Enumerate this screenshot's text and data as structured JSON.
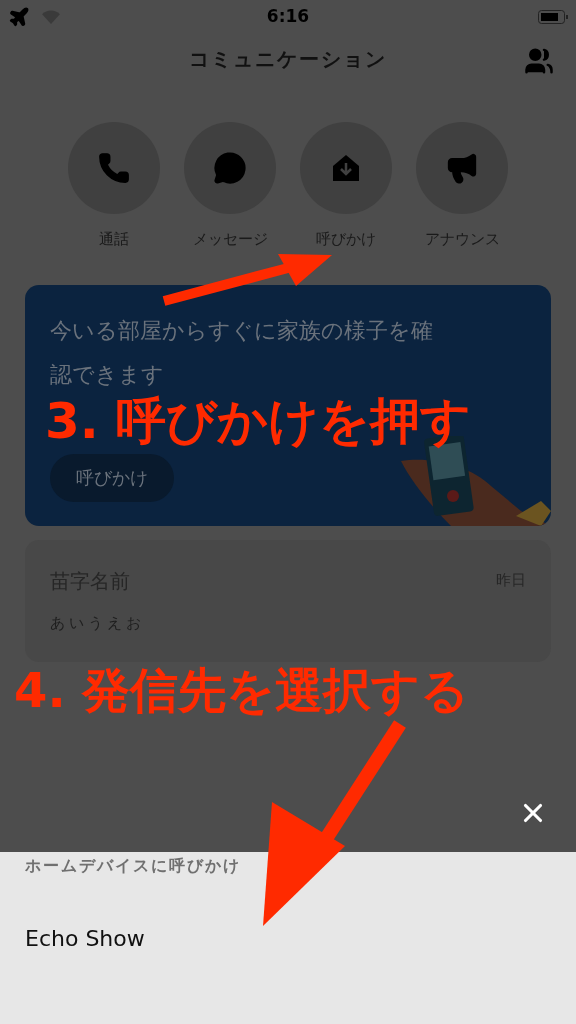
{
  "status_bar": {
    "time": "6:16"
  },
  "header": {
    "title": "コミュニケーション"
  },
  "actions": [
    {
      "kind": "call",
      "label": "通話"
    },
    {
      "kind": "message",
      "label": "メッセージ"
    },
    {
      "kind": "drop_in",
      "label": "呼びかけ"
    },
    {
      "kind": "announce",
      "label": "アナウンス"
    }
  ],
  "banner": {
    "text": "今いる部屋からすぐに家族の様子を確認できます",
    "button": "呼びかけ"
  },
  "conversations": [
    {
      "name": "苗字名前",
      "time": "昨日",
      "preview": "あいうえお"
    }
  ],
  "sheet": {
    "title": "ホームデバイスに呼びかけ",
    "devices": [
      "Echo Show"
    ]
  },
  "annotations": [
    {
      "text": "3. 呼びかけを押す"
    },
    {
      "text": "4. 発信先を選択する"
    }
  ]
}
